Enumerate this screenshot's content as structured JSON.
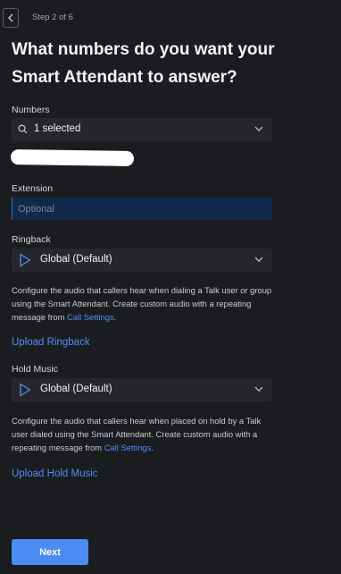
{
  "header": {
    "back_icon": "chevron-left-icon",
    "step_text": "Step 2 of 6"
  },
  "title": "What numbers do you want your Smart Attendant to answer?",
  "numbers": {
    "label": "Numbers",
    "selected_text": "1 selected"
  },
  "extension": {
    "label": "Extension",
    "placeholder": "Optional",
    "value": ""
  },
  "ringback": {
    "label": "Ringback",
    "selected": "Global (Default)",
    "description_prefix": "Configure the audio that callers hear when dialing a Talk user or group using the Smart Attendant. Create custom audio with a repeating message from ",
    "description_link": "Call Settings",
    "description_suffix": ".",
    "upload_label": "Upload Ringback"
  },
  "hold_music": {
    "label": "Hold Music",
    "selected": "Global (Default)",
    "description_prefix": "Configure the audio that callers hear when placed on hold by a Talk user dialed using the Smart Attendant. Create custom audio with a repeating message from ",
    "description_link": "Call Settings",
    "description_suffix": ".",
    "upload_label": "Upload Hold Music"
  },
  "footer": {
    "next_label": "Next"
  },
  "colors": {
    "background": "#1b1c1f",
    "accent": "#4a8cf2",
    "link": "#4f8ef7",
    "input_active": "#11294a"
  }
}
